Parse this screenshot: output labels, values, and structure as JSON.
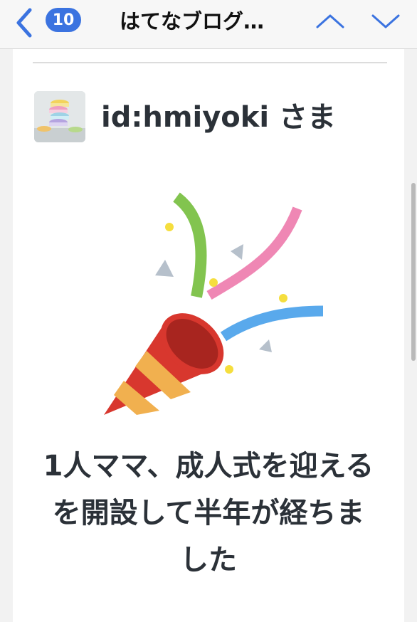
{
  "nav": {
    "back_icon": "chevron-left-icon",
    "badge_count": "10",
    "title": "はてなブログ…",
    "up_icon": "chevron-up-icon",
    "down_icon": "chevron-down-icon",
    "accent_color": "#3b73e0"
  },
  "email": {
    "user_id": "id:hmiyoki",
    "honorific": "さま",
    "illustration": "party-popper-icon",
    "message": "1人ママ、成人式を迎える を開設して半年が経ちました"
  }
}
